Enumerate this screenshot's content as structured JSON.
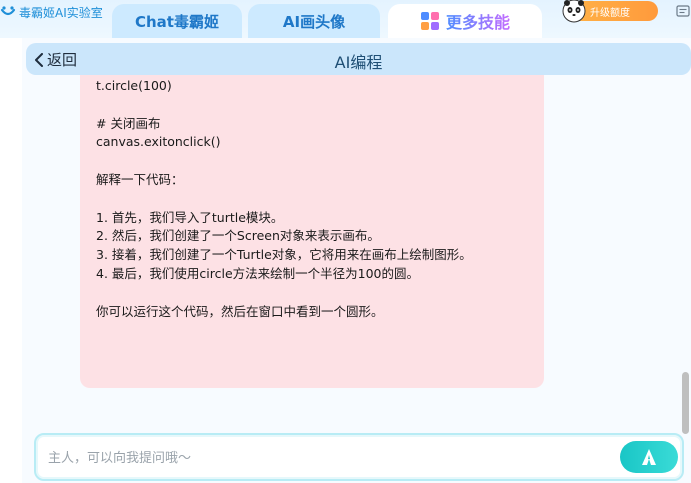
{
  "app": {
    "brand": "毒霸姬AI实验室"
  },
  "tabs": [
    {
      "label": "Chat毒霸姬"
    },
    {
      "label": "AI画头像"
    },
    {
      "label": "更多技能"
    }
  ],
  "upgrade": {
    "label": "升级额度"
  },
  "header": {
    "back_label": "返回",
    "title": "AI编程"
  },
  "message": {
    "lines": [
      "t.circle(100)",
      "",
      "# 关闭画布",
      "canvas.exitonclick()",
      "",
      "解释一下代码：",
      "",
      "1. 首先，我们导入了turtle模块。",
      "2. 然后，我们创建了一个Screen对象来表示画布。",
      "3. 接着，我们创建了一个Turtle对象，它将用来在画布上绘制图形。",
      "4. 最后，我们使用circle方法来绘制一个半径为100的圆。",
      "",
      "你可以运行这个代码，然后在窗口中看到一个圆形。"
    ]
  },
  "input": {
    "placeholder": "主人，可以向我提问哦～"
  },
  "colors": {
    "accent": "#1f78c8",
    "bubble": "#fde1e5",
    "send": "#19c6c6"
  }
}
